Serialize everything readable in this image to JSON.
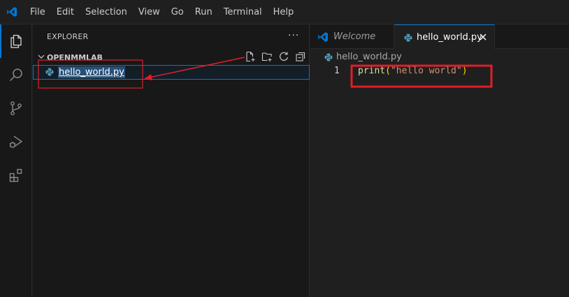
{
  "menu": [
    "File",
    "Edit",
    "Selection",
    "View",
    "Go",
    "Run",
    "Terminal",
    "Help"
  ],
  "sidebar": {
    "title": "EXPLORER",
    "more": "···",
    "folder": "OPENMMLAB",
    "file": "hello_world.py"
  },
  "tabs": {
    "welcome": "Welcome",
    "active": "hello_world.py"
  },
  "editor": {
    "breadcrumb": "hello_world.py",
    "line_number": "1",
    "code": {
      "fn": "print",
      "open": "(",
      "str": "\"hello world\"",
      "close": ")"
    }
  },
  "colors": {
    "accent": "#0078d4",
    "annotation": "#e01e2a",
    "python_icon": "#519aba"
  }
}
